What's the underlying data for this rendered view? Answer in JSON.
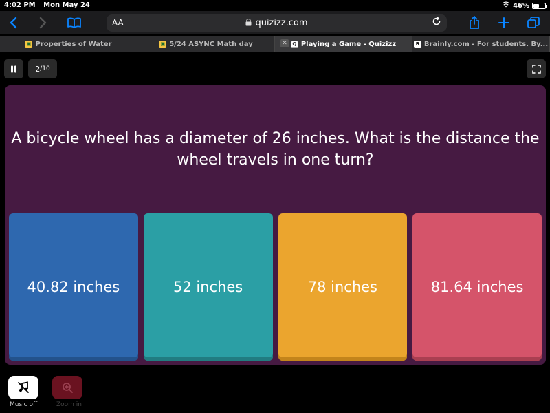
{
  "status": {
    "time": "4:02 PM",
    "date": "Mon May 24",
    "battery": "46%"
  },
  "browser": {
    "text_size_label": "AA",
    "url": "quizizz.com",
    "tabs": [
      {
        "label": "Properties of Water",
        "active": false
      },
      {
        "label": "5/24 ASYNC Math day",
        "active": false
      },
      {
        "label": "Playing a Game - Quizizz",
        "active": true
      },
      {
        "label": "Brainly.com - For students. By...",
        "active": false
      }
    ]
  },
  "quiz": {
    "progress_current": "2",
    "progress_total": "/10",
    "question": "A bicycle wheel has a diameter of 26 inches. What is the distance the wheel travels in one turn?",
    "options": [
      "40.82 inches",
      "52 inches",
      "78 inches",
      "81.64 inches"
    ]
  },
  "footer": {
    "music_label": "Music off",
    "zoom_label": "Zoom in"
  },
  "colors": {
    "card": "#461a42",
    "opt_blue": "#2e68af",
    "opt_teal": "#2b9fa5",
    "opt_orange": "#eba52e",
    "opt_pink": "#d5546a"
  }
}
